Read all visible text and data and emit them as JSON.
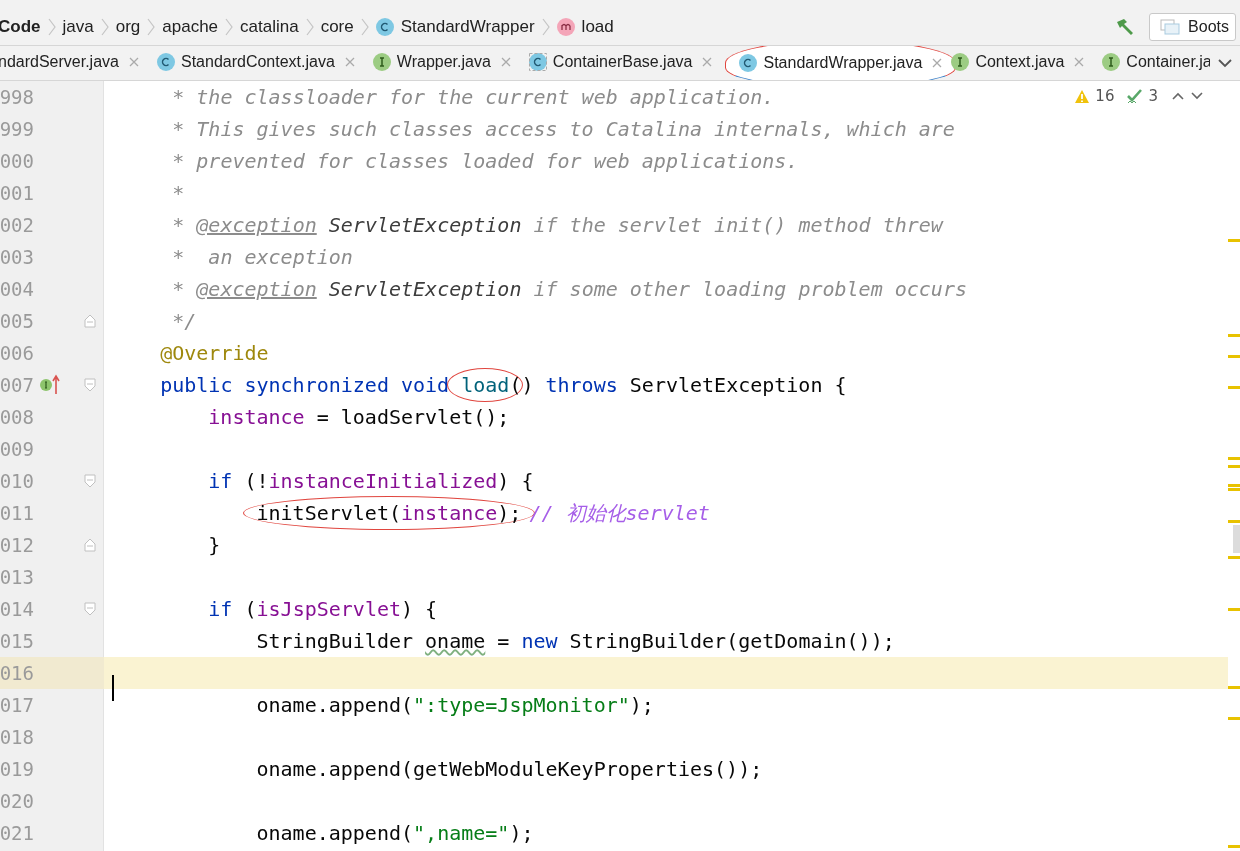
{
  "breadcrumbs": [
    {
      "label": "Code",
      "kind": "module"
    },
    {
      "label": "java",
      "kind": "package"
    },
    {
      "label": "org",
      "kind": "package"
    },
    {
      "label": "apache",
      "kind": "package"
    },
    {
      "label": "catalina",
      "kind": "package"
    },
    {
      "label": "core",
      "kind": "package"
    },
    {
      "label": "StandardWrapper",
      "kind": "class"
    },
    {
      "label": "load",
      "kind": "method"
    }
  ],
  "toolbar": {
    "run_config": "Boots"
  },
  "tabs": [
    {
      "label": "ndardServer.java",
      "kind": "cut",
      "selected": false,
      "circled": false
    },
    {
      "label": "StandardContext.java",
      "kind": "class",
      "selected": false,
      "circled": false
    },
    {
      "label": "Wrapper.java",
      "kind": "interface",
      "selected": false,
      "circled": false
    },
    {
      "label": "ContainerBase.java",
      "kind": "abstract",
      "selected": false,
      "circled": false
    },
    {
      "label": "StandardWrapper.java",
      "kind": "class",
      "selected": true,
      "circled": true
    },
    {
      "label": "Context.java",
      "kind": "interface",
      "selected": false,
      "circled": false
    },
    {
      "label": "Container.ja",
      "kind": "interface",
      "selected": false,
      "circled": false
    }
  ],
  "inspections": {
    "warnings": "16",
    "weak_warnings": "3"
  },
  "lines": [
    {
      "number": "998",
      "current": false,
      "fold_start": false,
      "fold_end": false,
      "implements_marker": false,
      "tokens": [
        {
          "kind": "comment",
          "text": "     * the classloader for the current web application."
        }
      ]
    },
    {
      "number": "999",
      "current": false,
      "fold_start": false,
      "fold_end": false,
      "implements_marker": false,
      "tokens": [
        {
          "kind": "comment",
          "text": "     * This gives such classes access to Catalina internals, which are"
        }
      ]
    },
    {
      "number": "000",
      "current": false,
      "fold_start": false,
      "fold_end": false,
      "implements_marker": false,
      "tokens": [
        {
          "kind": "comment",
          "text": "     * prevented for classes loaded for web applications."
        }
      ]
    },
    {
      "number": "001",
      "current": false,
      "fold_start": false,
      "fold_end": false,
      "implements_marker": false,
      "tokens": [
        {
          "kind": "comment",
          "text": "     *"
        }
      ]
    },
    {
      "number": "002",
      "current": false,
      "fold_start": false,
      "fold_end": false,
      "implements_marker": false,
      "tokens": [
        {
          "kind": "comment",
          "text": "     * "
        },
        {
          "kind": "doc-tag",
          "text": "@exception"
        },
        {
          "kind": "doc-ref",
          "text": " ServletException"
        },
        {
          "kind": "comment",
          "text": " if the servlet init() method threw"
        }
      ]
    },
    {
      "number": "003",
      "current": false,
      "fold_start": false,
      "fold_end": false,
      "implements_marker": false,
      "tokens": [
        {
          "kind": "comment",
          "text": "     *  an exception"
        }
      ]
    },
    {
      "number": "004",
      "current": false,
      "fold_start": false,
      "fold_end": false,
      "implements_marker": false,
      "tokens": [
        {
          "kind": "comment",
          "text": "     * "
        },
        {
          "kind": "doc-tag",
          "text": "@exception"
        },
        {
          "kind": "doc-ref",
          "text": " ServletException"
        },
        {
          "kind": "comment",
          "text": " if some other loading problem occurs"
        }
      ]
    },
    {
      "number": "005",
      "current": false,
      "fold_start": false,
      "fold_end": true,
      "implements_marker": false,
      "tokens": [
        {
          "kind": "comment",
          "text": "     */"
        }
      ]
    },
    {
      "number": "006",
      "current": false,
      "fold_start": false,
      "fold_end": false,
      "implements_marker": false,
      "tokens": [
        {
          "kind": "annotation",
          "text": "    @Override"
        }
      ]
    },
    {
      "number": "007",
      "current": false,
      "fold_start": true,
      "fold_end": false,
      "implements_marker": true,
      "tokens": [
        {
          "kind": "keyword",
          "text": "    public synchronized void "
        },
        {
          "kind": "circled",
          "parts": [
            {
              "kind": "method",
              "text": "load"
            }
          ]
        },
        {
          "kind": "plain",
          "text": "() "
        },
        {
          "kind": "keyword",
          "text": "throws"
        },
        {
          "kind": "plain",
          "text": " ServletException {"
        }
      ]
    },
    {
      "number": "008",
      "current": false,
      "fold_start": false,
      "fold_end": false,
      "implements_marker": false,
      "tokens": [
        {
          "kind": "field",
          "text": "        instance"
        },
        {
          "kind": "plain",
          "text": " = loadServlet();"
        }
      ]
    },
    {
      "number": "009",
      "current": false,
      "fold_start": false,
      "fold_end": false,
      "implements_marker": false
    },
    {
      "number": "010",
      "current": false,
      "fold_start": true,
      "fold_end": false,
      "implements_marker": false,
      "tokens": [
        {
          "kind": "keyword",
          "text": "        if"
        },
        {
          "kind": "plain",
          "text": " (!"
        },
        {
          "kind": "field",
          "text": "instanceInitialized"
        },
        {
          "kind": "plain",
          "text": ") {"
        }
      ]
    },
    {
      "number": "011",
      "current": false,
      "fold_start": false,
      "fold_end": false,
      "implements_marker": false,
      "tokens": [
        {
          "kind": "circled",
          "parts": [
            {
              "kind": "plain",
              "text": "            initServlet("
            },
            {
              "kind": "field",
              "text": "instance"
            },
            {
              "kind": "plain",
              "text": ");"
            }
          ]
        },
        {
          "kind": "line-comment",
          "text": "// 初始化servlet"
        }
      ]
    },
    {
      "number": "012",
      "current": false,
      "fold_start": false,
      "fold_end": true,
      "implements_marker": false,
      "tokens": [
        {
          "kind": "plain",
          "text": "        }"
        }
      ]
    },
    {
      "number": "013",
      "current": false,
      "fold_start": false,
      "fold_end": false,
      "implements_marker": false
    },
    {
      "number": "014",
      "current": false,
      "fold_start": true,
      "fold_end": false,
      "implements_marker": false,
      "tokens": [
        {
          "kind": "keyword",
          "text": "        if"
        },
        {
          "kind": "plain",
          "text": " ("
        },
        {
          "kind": "field",
          "text": "isJspServlet"
        },
        {
          "kind": "plain",
          "text": ") {"
        }
      ]
    },
    {
      "number": "015",
      "current": false,
      "fold_start": false,
      "fold_end": false,
      "implements_marker": false,
      "tokens": [
        {
          "kind": "plain",
          "text": "            StringBuilder "
        },
        {
          "kind": "typo",
          "text": "oname"
        },
        {
          "kind": "plain",
          "text": " = "
        },
        {
          "kind": "keyword",
          "text": "new"
        },
        {
          "kind": "plain",
          "text": " StringBuilder(getDomain());"
        }
      ]
    },
    {
      "number": "016",
      "current": true,
      "fold_start": false,
      "fold_end": false,
      "implements_marker": false
    },
    {
      "number": "017",
      "current": false,
      "fold_start": false,
      "fold_end": false,
      "implements_marker": false,
      "tokens": [
        {
          "kind": "plain",
          "text": "            oname.append("
        },
        {
          "kind": "string",
          "text": "\":type=JspMonitor\""
        },
        {
          "kind": "plain",
          "text": ");"
        }
      ]
    },
    {
      "number": "018",
      "current": false,
      "fold_start": false,
      "fold_end": false,
      "implements_marker": false
    },
    {
      "number": "019",
      "current": false,
      "fold_start": false,
      "fold_end": false,
      "implements_marker": false,
      "tokens": [
        {
          "kind": "plain",
          "text": "            oname.append(getWebModuleKeyProperties());"
        }
      ]
    },
    {
      "number": "020",
      "current": false,
      "fold_start": false,
      "fold_end": false,
      "implements_marker": false
    },
    {
      "number": "021",
      "current": false,
      "fold_start": false,
      "fold_end": false,
      "implements_marker": false,
      "tokens": [
        {
          "kind": "plain",
          "text": "            oname.append("
        },
        {
          "kind": "string",
          "text": "\",name=\""
        },
        {
          "kind": "plain",
          "text": ");"
        }
      ]
    }
  ]
}
